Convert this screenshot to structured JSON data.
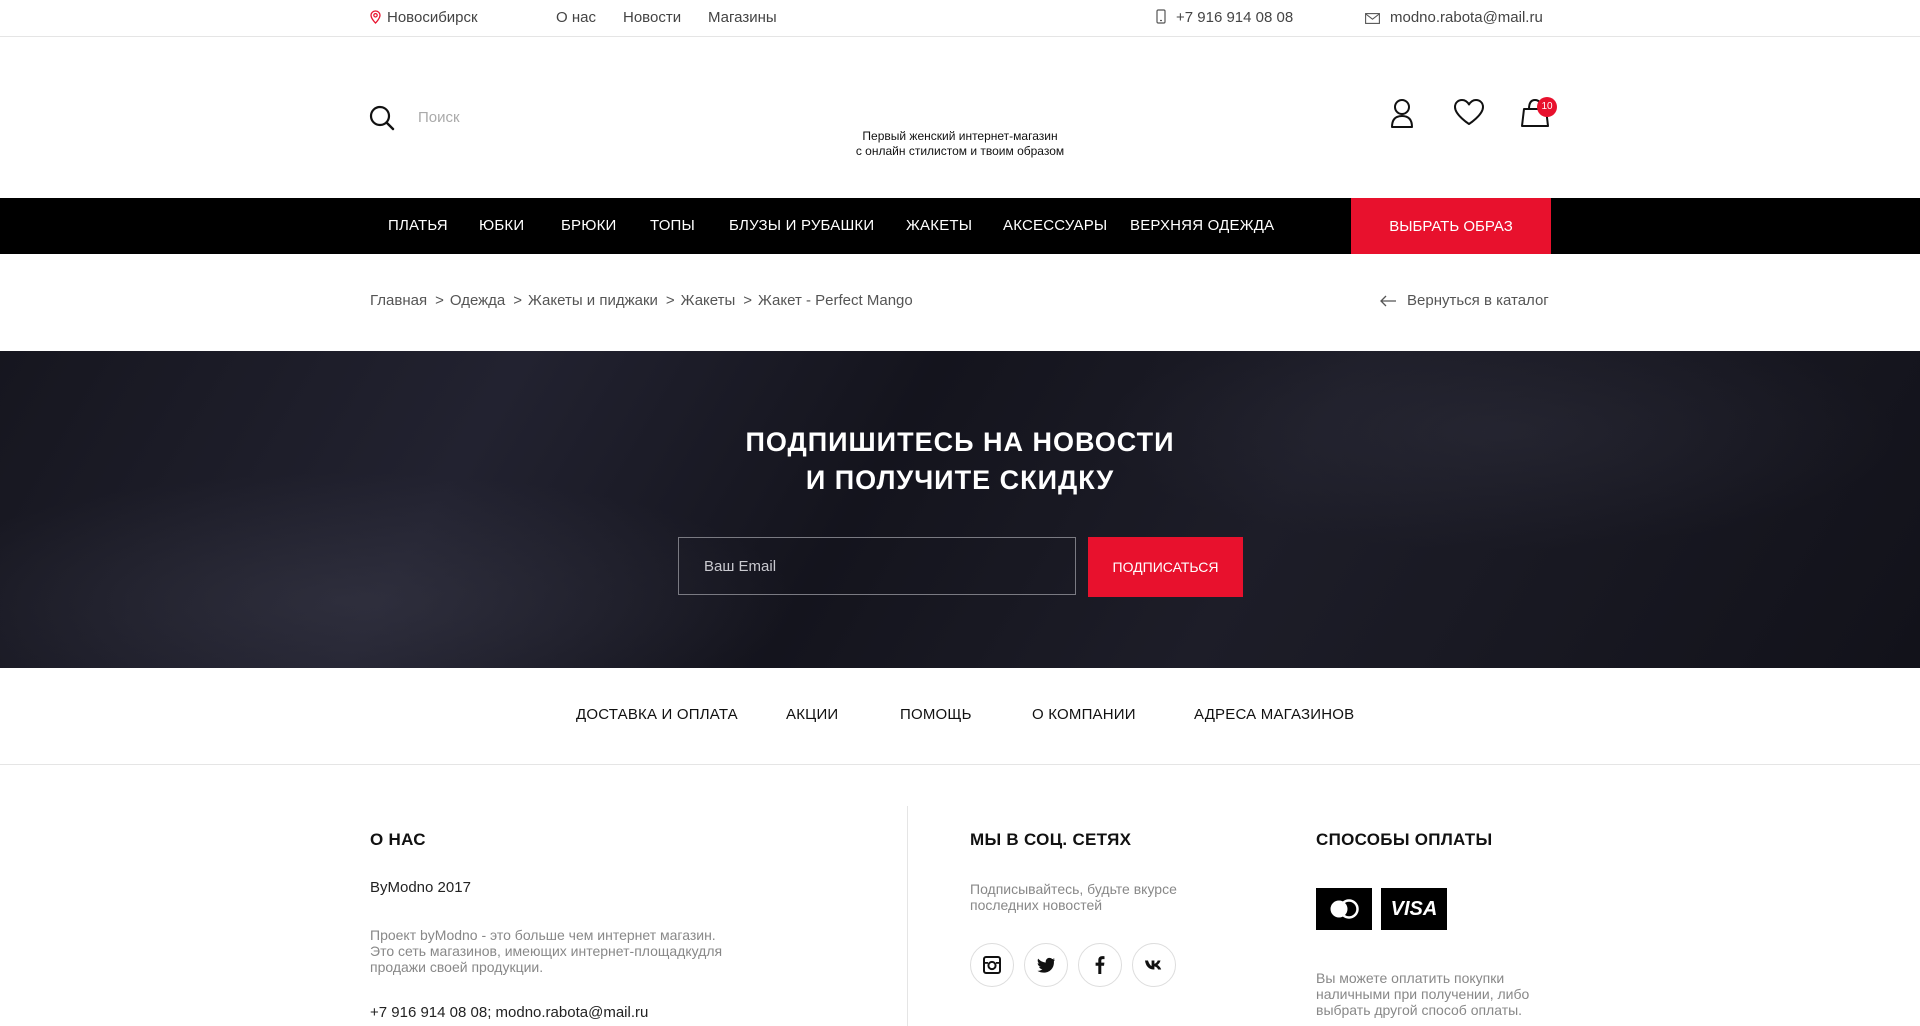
{
  "topbar": {
    "city": "Новосибирск",
    "links": [
      "О нас",
      "Новости",
      "Магазины"
    ],
    "phone": "+7 916 914 08 08",
    "email": "modno.rabota@mail.ru"
  },
  "header": {
    "search_placeholder": "Поиск",
    "tagline_line1": "Первый женский интернет-магазин",
    "tagline_line2": "с онлайн стилистом и твоим образом",
    "cart_count": "10"
  },
  "nav": {
    "items": [
      "ПЛАТЬЯ",
      "ЮБКИ",
      "БРЮКИ",
      "ТОПЫ",
      "БЛУЗЫ И РУБАШКИ",
      "ЖАКЕТЫ",
      "АКСЕССУАРЫ",
      "ВЕРХНЯЯ ОДЕЖДА"
    ],
    "cta": "ВЫБРАТЬ ОБРАЗ"
  },
  "breadcrumb": {
    "items": [
      "Главная",
      "Одежда",
      "Жакеты и пиджаки",
      "Жакеты",
      "Жакет - Perfect Mango"
    ],
    "separator": ">",
    "back": "Вернуться в каталог"
  },
  "subscribe": {
    "title_line1": "ПОДПИШИТЕСЬ НА НОВОСТИ",
    "title_line2": "И ПОЛУЧИТЕ СКИДКУ",
    "email_placeholder": "Ваш Email",
    "button": "ПОДПИСАТЬСЯ"
  },
  "footer_links": [
    "ДОСТАВКА И ОПЛАТА",
    "АКЦИИ",
    "ПОМОЩЬ",
    "О КОМПАНИИ",
    "АДРЕСА МАГАЗИНОВ"
  ],
  "footer": {
    "about": {
      "heading": "О НАС",
      "brand": "ByModno 2017",
      "text": "Проект byModno - это больше чем интернет магазин. Это сеть магазинов, имеющих интернет-площадкудля продажи своей продукции.",
      "contacts": "+7 916 914 08 08; modno.rabota@mail.ru"
    },
    "social": {
      "heading": "МЫ В СОЦ. СЕТЯХ",
      "text": "Подписывайтесь, будьте вкурсе последних новостей",
      "icons": [
        "instagram-icon",
        "twitter-icon",
        "facebook-icon",
        "vk-icon"
      ]
    },
    "payment": {
      "heading": "СПОСОБЫ ОПЛАТЫ",
      "visa_label": "VISA",
      "text": "Вы можете оплатить покупки наличными при получении, либо выбрать другой способ оплаты."
    }
  },
  "colors": {
    "accent": "#e8112d",
    "nav_bg": "#000000",
    "subscribe_bg": "#18181f"
  }
}
